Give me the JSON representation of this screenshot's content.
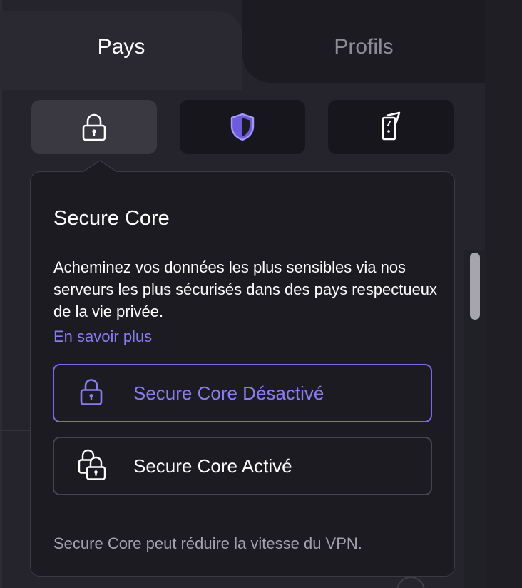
{
  "tabs": [
    {
      "label": "Pays",
      "active": true
    },
    {
      "label": "Profils",
      "active": false
    }
  ],
  "filters": [
    {
      "name": "secure-core",
      "icon": "lock-icon",
      "selected": true
    },
    {
      "name": "netshield",
      "icon": "shield-icon",
      "selected": false
    },
    {
      "name": "streaming",
      "icon": "door-icon",
      "selected": false
    }
  ],
  "popover": {
    "title": "Secure Core",
    "description": "Acheminez vos données les plus sensibles via nos serveurs les plus sécurisés dans des pays respectueux de la vie privée.",
    "learn_more": "En savoir plus",
    "options": [
      {
        "label": "Secure Core Désactivé",
        "icon": "lock-icon",
        "selected": true
      },
      {
        "label": "Secure Core Activé",
        "icon": "double-lock-icon",
        "selected": false
      }
    ],
    "footnote": "Secure Core peut réduire la vitesse du VPN."
  },
  "colors": {
    "accent": "#8a7cf3",
    "accent_border": "#7b69eb",
    "background": "#1b1a21",
    "popover": "#1c1b22",
    "text": "#ffffff",
    "muted": "#a4a3ab"
  }
}
